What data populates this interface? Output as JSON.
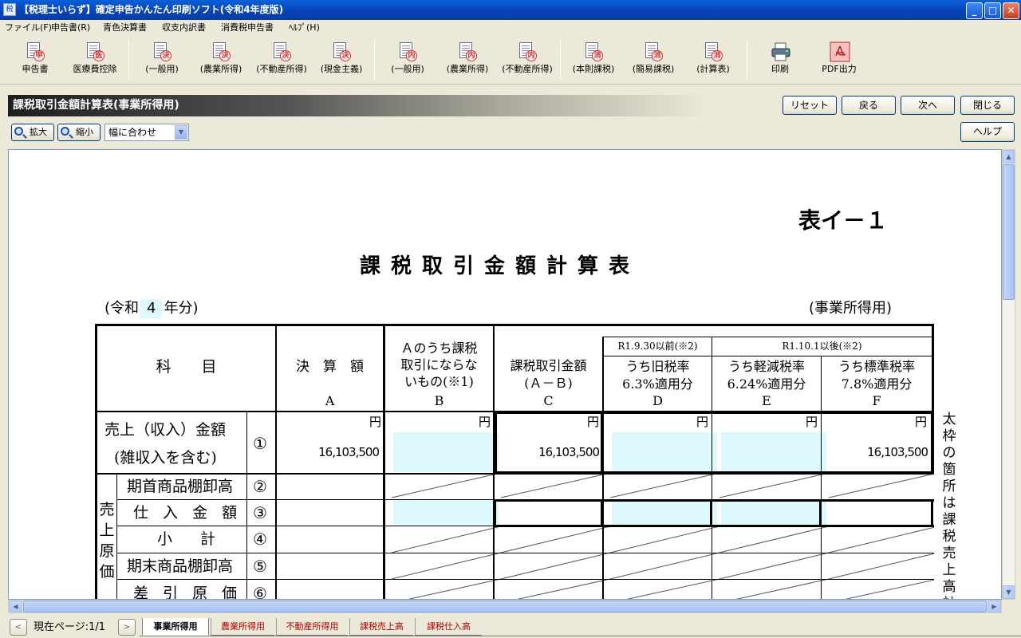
{
  "window": {
    "title": "【税理士いらず】確定申告かんたん印刷ソフト(令和4年度版)",
    "minimize": "_",
    "maximize": "□",
    "close": "✕"
  },
  "menu": [
    "ファイル(F)",
    "申告書(R)",
    "青色決算書",
    "収支内訳書",
    "消費税申告書",
    "ﾍﾙﾌﾟ(H)"
  ],
  "toolbar": [
    {
      "label": "申告書",
      "badge": "申",
      "icon": "document-icon"
    },
    {
      "label": "医療費控除",
      "badge": "医",
      "icon": "document-icon"
    },
    {
      "label": "(一般用)",
      "badge": "決",
      "icon": "document-icon"
    },
    {
      "label": "(農業所得)",
      "badge": "決",
      "icon": "document-icon"
    },
    {
      "label": "(不動産所得)",
      "badge": "決",
      "icon": "document-icon"
    },
    {
      "label": "(現金主義)",
      "badge": "決",
      "icon": "document-icon"
    },
    {
      "label": "(一般用)",
      "badge": "内",
      "icon": "document-icon"
    },
    {
      "label": "(農業所得)",
      "badge": "内",
      "icon": "document-icon"
    },
    {
      "label": "(不動産所得)",
      "badge": "内",
      "icon": "document-icon"
    },
    {
      "label": "(本則課税)",
      "badge": "消",
      "icon": "document-icon"
    },
    {
      "label": "(簡易課税)",
      "badge": "消",
      "icon": "document-icon"
    },
    {
      "label": "(計算表)",
      "badge": "消",
      "icon": "document-icon"
    },
    {
      "label": "印刷",
      "badge": "",
      "icon": "printer-icon"
    },
    {
      "label": "PDF出力",
      "badge": "",
      "icon": "pdf-icon"
    }
  ],
  "header": {
    "title": "課税取引金額計算表(事業所得用)",
    "buttons": {
      "reset": "リセット",
      "back": "戻る",
      "next": "次へ",
      "close": "閉じる",
      "help": "ヘルプ"
    }
  },
  "zoom": {
    "zoom_in": "拡大",
    "zoom_out": "縮小",
    "select_value": "幅に合わせ"
  },
  "document": {
    "code": "表イ－１",
    "title": "課税取引金額計算表",
    "year_prefix": "(令和",
    "year_value": "4",
    "year_suffix": "年分)",
    "business_label": "(事業所得用)",
    "columns": {
      "subject": "科　　目",
      "a_title": "決　算　額",
      "a_letter": "A",
      "b_line1": "Ａのうち課税",
      "b_line2": "取引にならな",
      "b_line3": "いもの(※1)",
      "b_letter": "B",
      "c_line1": "課税取引金額",
      "c_line2": "(Ａ－Ｂ)",
      "c_letter": "C",
      "r1_before": "R1.9.30以前(※2)",
      "r1_after": "R1.10.1以後(※2)",
      "d_line1": "うち旧税率",
      "d_line2": "6.3%適用分",
      "d_letter": "D",
      "e_line1": "うち軽減税率",
      "e_line2": "6.24%適用分",
      "e_letter": "E",
      "f_line1": "うち標準税率",
      "f_line2": "7.8%適用分",
      "f_letter": "F"
    },
    "yen": "円",
    "rows": {
      "sales_line1": "売上（収入）金額",
      "sales_line2": "(雑収入を含む)",
      "sales_no": "①",
      "sales_a": "16,103,500",
      "sales_c": "16,103,500",
      "sales_f": "16,103,500",
      "cogs_group": [
        "売",
        "上",
        "原",
        "価"
      ],
      "opening_stock": "期首商品棚卸高",
      "opening_no": "②",
      "purchases": "仕 入 金 額",
      "purchases_no": "③",
      "subtotal": "小　計",
      "subtotal_no": "④",
      "closing_stock": "期末商品棚卸高",
      "closing_no": "⑤",
      "cost_of_sales": "差 引 原 価",
      "cost_no": "⑥"
    },
    "side_note": "太枠の箇所は課税売上高計算"
  },
  "statusbar": {
    "page_info": "現在ページ:1/1",
    "tabs": [
      "事業所得用",
      "農業所得用",
      "不動産所得用",
      "課税売上高",
      "課税仕入高"
    ],
    "active_tab": 0
  }
}
